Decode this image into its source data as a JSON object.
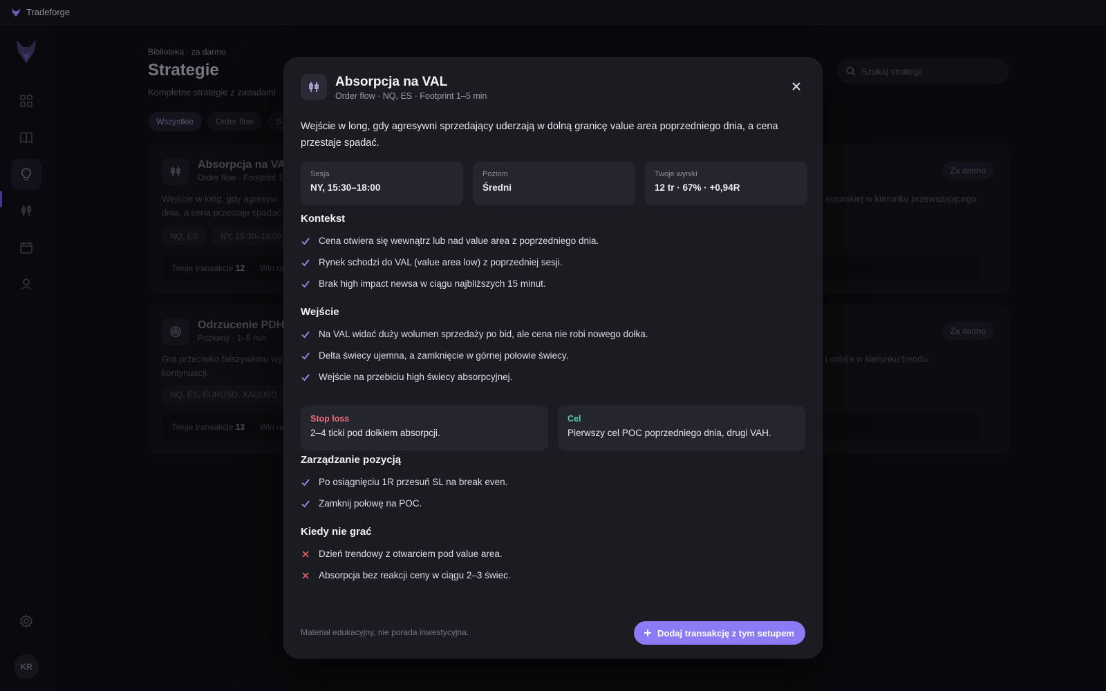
{
  "app": {
    "name": "Tradeforge"
  },
  "sidebar": {
    "avatar_initials": "KR"
  },
  "page": {
    "breadcrumb": "Biblioteka · za darmo",
    "title": "Strategie",
    "subtitle": "Kompletne strategie z zasadami",
    "search_placeholder": "Szukaj strategii",
    "filters": [
      "Wszystkie",
      "Order flow",
      "S"
    ],
    "cards": [
      {
        "title": "Absorpcja na VAL",
        "meta": "Order flow · Footprint 1",
        "badge": "Za darmo",
        "desc_left_1": "Wejście w long, gdy agresyw",
        "desc_left_2": "dnia, a cena przestaje spadać.",
        "desc_right": "eojorskiej w kierunku przeważającego",
        "tags": [
          "NQ, ES",
          "NY, 15:30–18:00"
        ],
        "stats_label": "Twoje transakcje",
        "stats_value": "12",
        "stats_winrate_label": "Win ra"
      },
      {
        "title": "Odrzucenie PDH ,",
        "meta": "Poziomy · 1–5 min",
        "badge": "Za darmo",
        "desc_left_1": "Gra przeciwko fałszywemu wy",
        "desc_left_2": "kontynuacji.",
        "desc_right": "i odbija w kierunku trendu.",
        "tags": [
          "NQ, ES, EURUSD, XAUUSD"
        ],
        "stats_label": "Twoje transakcje",
        "stats_value": "13",
        "stats_winrate_label": "Win ra"
      }
    ]
  },
  "modal": {
    "title": "Absorpcja na VAL",
    "meta": "Order flow · NQ, ES · Footprint 1–5 min",
    "description": "Wejście w long, gdy agresywni sprzedający uderzają w dolną granicę value area poprzedniego dnia, a cena przestaje spadać.",
    "info": [
      {
        "label": "Sesja",
        "value": "NY, 15:30–18:00"
      },
      {
        "label": "Poziom",
        "value": "Średni"
      },
      {
        "label": "Twoje wyniki",
        "value": "12 tr · 67% · +0,94R"
      }
    ],
    "sections": {
      "kontekst": {
        "title": "Kontekst",
        "items": [
          "Cena otwiera się wewnątrz lub nad value area z poprzedniego dnia.",
          "Rynek schodzi do VAL (value area low) z poprzedniej sesji.",
          "Brak high impact newsa w ciągu najbliższych 15 minut."
        ]
      },
      "wejscie": {
        "title": "Wejście",
        "items": [
          "Na VAL widać duży wolumen sprzedaży po bid, ale cena nie robi nowego dołka.",
          "Delta świecy ujemna, a zamknięcie w górnej połowie świecy.",
          "Wejście na przebiciu high świecy absorpcyjnej."
        ]
      },
      "zarzadzanie": {
        "title": "Zarządzanie pozycją",
        "items": [
          "Po osiągnięciu 1R przesuń SL na break even.",
          "Zamknij połowę na POC."
        ]
      },
      "nie_grac": {
        "title": "Kiedy nie grać",
        "items": [
          "Dzień trendowy z otwarciem pod value area.",
          "Absorpcja bez reakcji ceny w ciągu 2–3 świec."
        ]
      }
    },
    "stop_loss": {
      "label": "Stop loss",
      "value": "2–4 ticki pod dołkiem absorpcji."
    },
    "target": {
      "label": "Cel",
      "value": "Pierwszy cel POC poprzedniego dnia, drugi VAH."
    },
    "footer_note": "Materiał edukacyjny, nie porada inwestycyjna.",
    "cta_label": "Dodaj transakcję z tym setupem"
  },
  "colors": {
    "accent": "#8b7cf6",
    "check": "#9b8ff0",
    "cross": "#e05c6b",
    "stop_loss": "#ea6f7e",
    "target": "#4fd3a0"
  }
}
